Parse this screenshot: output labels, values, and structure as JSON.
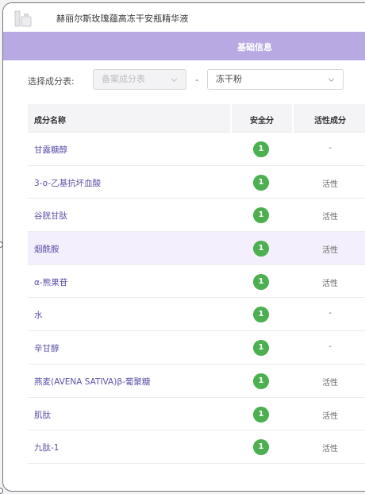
{
  "product": {
    "icon": "product-bottle-icon",
    "title": "赫丽尔斯玫瑰蕴高冻干安瓶精华液"
  },
  "tabs": {
    "basic_info": "基础信息"
  },
  "colors": {
    "tab_bar": "#b9a9e2",
    "link": "#5a50a8",
    "safety_badge": "#4caf50",
    "row_highlight": "#f4effc"
  },
  "filter": {
    "label": "选择成分表:",
    "filing_select": {
      "value": "备案成分表",
      "disabled": true
    },
    "separator": "-",
    "form_select": {
      "value": "冻干粉"
    }
  },
  "table": {
    "headers": {
      "name": "成分名称",
      "safety": "安全分",
      "active": "活性成分"
    },
    "rows": [
      {
        "name": "甘露糖醇",
        "safety": "1",
        "active": "-"
      },
      {
        "name": "3-o-乙基抗坏血酸",
        "safety": "1",
        "active": "活性"
      },
      {
        "name": "谷胱甘肽",
        "safety": "1",
        "active": "活性"
      },
      {
        "name": "烟酰胺",
        "safety": "1",
        "active": "活性"
      },
      {
        "name": "α-熊果苷",
        "safety": "1",
        "active": "活性"
      },
      {
        "name": "水",
        "safety": "1",
        "active": "-"
      },
      {
        "name": "辛甘醇",
        "safety": "1",
        "active": "-"
      },
      {
        "name": "燕麦(AVENA SATIVA)β-葡聚糖",
        "safety": "1",
        "active": "活性"
      },
      {
        "name": "肌肽",
        "safety": "1",
        "active": "活性"
      },
      {
        "name": "九肽-1",
        "safety": "1",
        "active": "活性"
      }
    ]
  }
}
